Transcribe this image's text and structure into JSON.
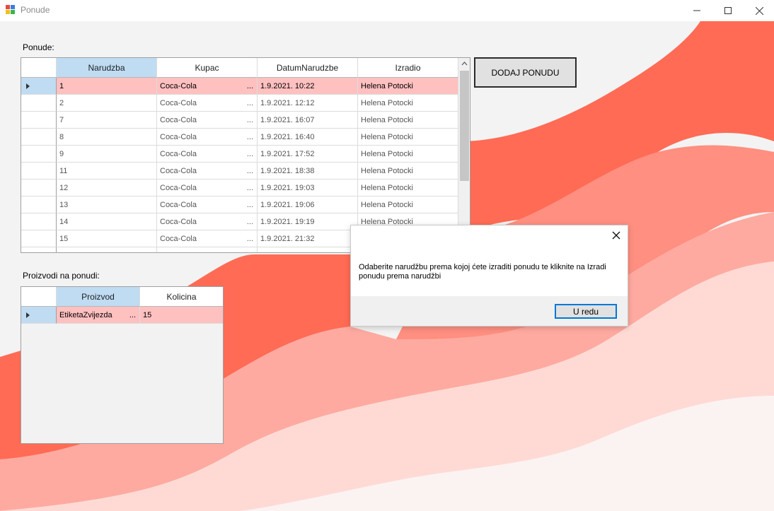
{
  "window": {
    "title": "Ponude"
  },
  "colors": {
    "accent": "#ff6b55",
    "selected_row": "#ffc0c0",
    "selected_header": "#bfdcf3"
  },
  "offers": {
    "label": "Ponude:",
    "columns": [
      "Narudzba",
      "Kupac",
      "DatumNarudzbe",
      "Izradio"
    ],
    "rows": [
      {
        "narudzba": "1",
        "kupac": "Coca-Cola",
        "datum": "1.9.2021. 10:22",
        "izradio": "Helena Potocki"
      },
      {
        "narudzba": "2",
        "kupac": "Coca-Cola",
        "datum": "1.9.2021. 12:12",
        "izradio": "Helena Potocki"
      },
      {
        "narudzba": "7",
        "kupac": "Coca-Cola",
        "datum": "1.9.2021. 16:07",
        "izradio": "Helena Potocki"
      },
      {
        "narudzba": "8",
        "kupac": "Coca-Cola",
        "datum": "1.9.2021. 16:40",
        "izradio": "Helena Potocki"
      },
      {
        "narudzba": "9",
        "kupac": "Coca-Cola",
        "datum": "1.9.2021. 17:52",
        "izradio": "Helena Potocki"
      },
      {
        "narudzba": "11",
        "kupac": "Coca-Cola",
        "datum": "1.9.2021. 18:38",
        "izradio": "Helena Potocki"
      },
      {
        "narudzba": "12",
        "kupac": "Coca-Cola",
        "datum": "1.9.2021. 19:03",
        "izradio": "Helena Potocki"
      },
      {
        "narudzba": "13",
        "kupac": "Coca-Cola",
        "datum": "1.9.2021. 19:06",
        "izradio": "Helena Potocki"
      },
      {
        "narudzba": "14",
        "kupac": "Coca-Cola",
        "datum": "1.9.2021. 19:19",
        "izradio": "Helena Potocki"
      },
      {
        "narudzba": "15",
        "kupac": "Coca-Cola",
        "datum": "1.9.2021. 21:32",
        "izradio": ""
      }
    ]
  },
  "products": {
    "label": "Proizvodi na ponudi:",
    "columns": [
      "Proizvod",
      "Kolicina"
    ],
    "rows": [
      {
        "proizvod": "EtiketaZvijezda",
        "kolicina": "15"
      }
    ]
  },
  "actions": {
    "add_offer": "DODAJ PONUDU"
  },
  "dialog": {
    "message": "Odaberite narudžbu prema kojoj ćete izraditi ponudu te kliknite na Izradi ponudu prema narudžbi",
    "ok_label": "U redu"
  },
  "icons": {
    "app": "app-icon",
    "minimize": "minimize-icon",
    "maximize": "maximize-icon",
    "close": "close-icon",
    "row_pointer": "row-pointer-icon",
    "scroll_up": "scroll-up-icon",
    "ellipsis": "ellipsis-icon"
  }
}
